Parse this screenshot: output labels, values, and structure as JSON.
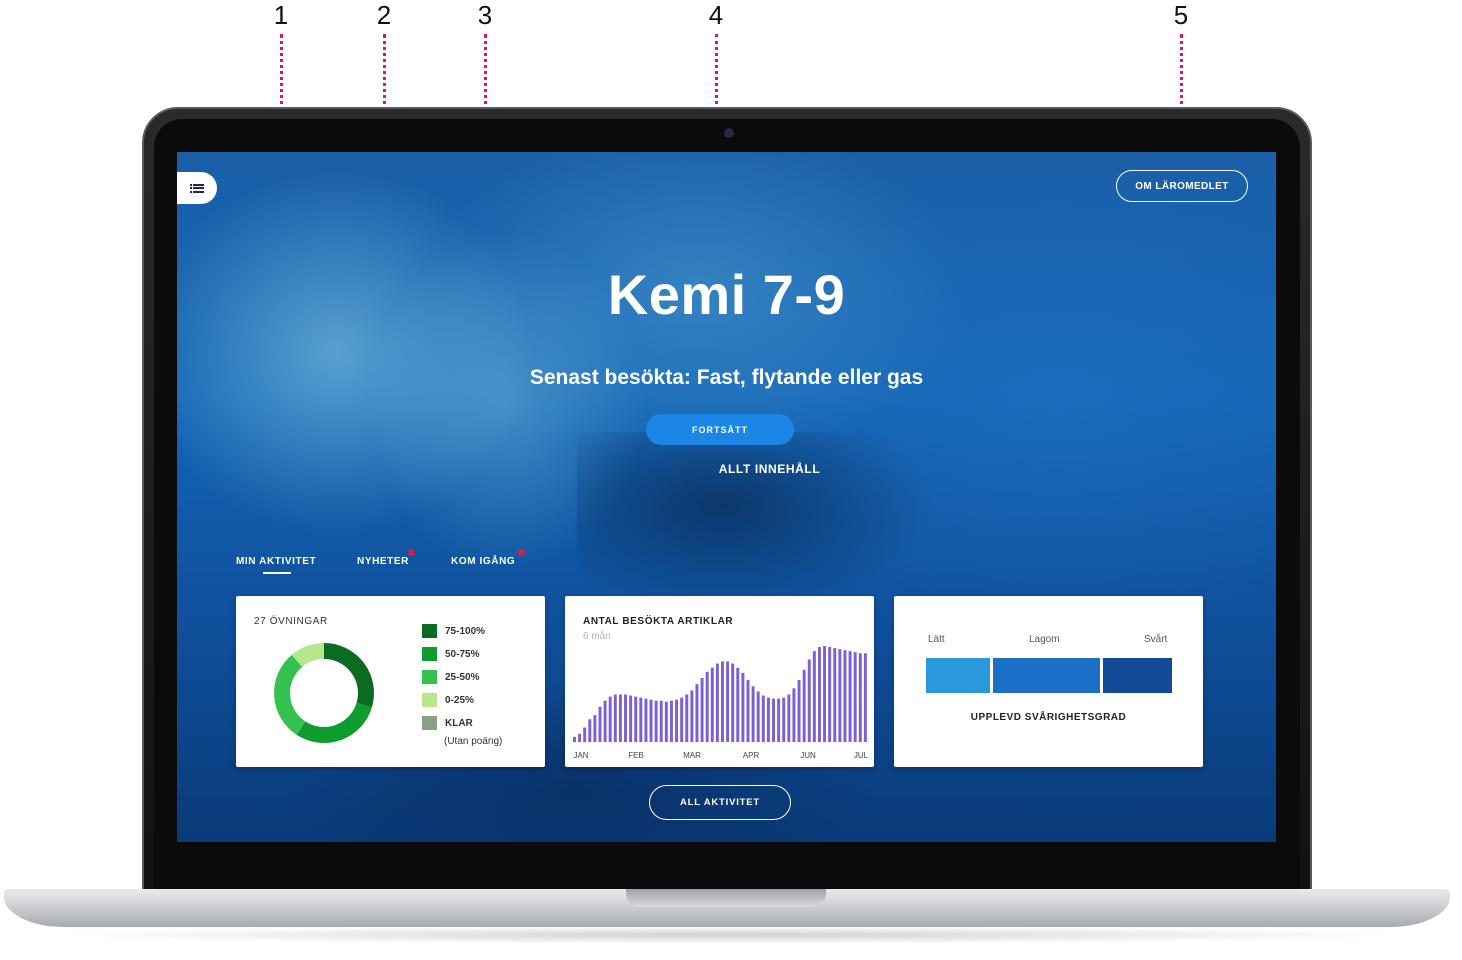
{
  "callouts": [
    "1",
    "2",
    "3",
    "4",
    "5"
  ],
  "menu": {
    "icon": "menu-list-icon"
  },
  "header": {
    "about_label": "OM LÄROMEDLET"
  },
  "hero": {
    "title": "Kemi 7-9",
    "last_visited": "Senast besökta: Fast, flytande eller gas",
    "continue_label": "FORTSÄTT",
    "all_content_label": "ALLT INNEHÅLL"
  },
  "tabs": [
    {
      "label": "MIN AKTIVITET",
      "active": true,
      "notification": false
    },
    {
      "label": "NYHETER",
      "active": false,
      "notification": true
    },
    {
      "label": "KOM IGÅNG",
      "active": false,
      "notification": true
    }
  ],
  "exercises_card": {
    "title": "27 ÖVNINGAR",
    "legend": [
      {
        "label": "75-100%",
        "color": "#0b6b23"
      },
      {
        "label": "50-75%",
        "color": "#0e9c2d"
      },
      {
        "label": "25-50%",
        "color": "#33c24f"
      },
      {
        "label": "0-25%",
        "color": "#b5e88d"
      },
      {
        "label": "KLAR",
        "color": "#8c9f86"
      }
    ],
    "legend_note": "(Utan poäng)"
  },
  "visits_card": {
    "title": "ANTAL BESÖKTA ARTIKLAR",
    "subtitle": "6 mån"
  },
  "difficulty_card": {
    "labels": [
      "Lätt",
      "Lagom",
      "Svårt"
    ],
    "caption": "UPPLEVD SVÅRIGHETSGRAD",
    "colors": [
      "#2a98dc",
      "#1b6fc6",
      "#124a98"
    ]
  },
  "all_activity_label": "ALL AKTIVITET",
  "chart_data": [
    {
      "type": "pie",
      "title": "27 ÖVNINGAR",
      "categories": [
        "75-100%",
        "50-75%",
        "25-50%",
        "0-25%"
      ],
      "values": [
        8,
        8,
        8,
        3
      ]
    },
    {
      "type": "bar",
      "title": "ANTAL BESÖKTA ARTIKLAR",
      "subtitle": "6 mån",
      "x_tick_labels": [
        "JAN",
        "FEB",
        "MAR",
        "APR",
        "JUN",
        "JUL"
      ],
      "values": [
        5,
        8,
        14,
        22,
        26,
        34,
        40,
        44,
        46,
        46,
        46,
        45,
        44,
        43,
        42,
        41,
        40,
        40,
        39,
        40,
        41,
        43,
        46,
        50,
        56,
        62,
        68,
        72,
        76,
        78,
        78,
        76,
        72,
        67,
        60,
        54,
        49,
        45,
        43,
        42,
        42,
        43,
        46,
        52,
        60,
        70,
        80,
        88,
        92,
        93,
        92,
        91,
        90,
        89,
        88,
        87,
        86,
        86
      ]
    }
  ]
}
